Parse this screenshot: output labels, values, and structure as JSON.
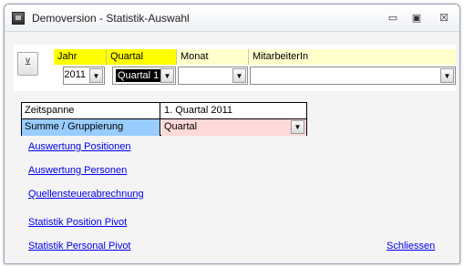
{
  "window": {
    "title": "Demoversion - Statistik-Auswahl"
  },
  "titlebar_buttons": {
    "minimize": "▭",
    "maximize": "▣",
    "close": "☒"
  },
  "filter": {
    "headers": {
      "year": "Jahr",
      "quarter": "Quartal",
      "month": "Monat",
      "employee": "MitarbeiterIn"
    },
    "values": {
      "year": "2011",
      "quarter": "Quartal 1",
      "month": "",
      "employee": ""
    },
    "dropdown_glyph": "▼",
    "filter_icon": "⊻"
  },
  "summary": {
    "period_label": "Zeitspanne",
    "period_value": "1. Quartal 2011",
    "group_label": "Summe / Gruppierung",
    "group_value": "Quartal"
  },
  "links": {
    "positions": "Auswertung Positionen",
    "persons": "Auswertung Personen",
    "withholding": "Quellensteuerabrechnung",
    "pivot_position": "Statistik Position Pivot",
    "pivot_personal": "Statistik Personal Pivot",
    "close": "Schliessen"
  },
  "colors": {
    "header_yellow": "#ffff00",
    "header_cream": "#ffffcc",
    "label_blue": "#99ccff",
    "value_pink": "#ffd9d9",
    "link_blue": "#0000ee"
  }
}
